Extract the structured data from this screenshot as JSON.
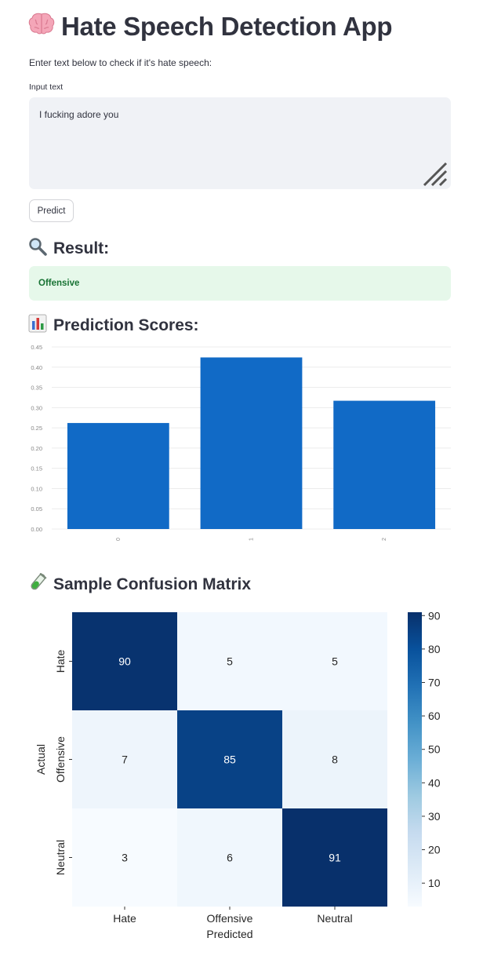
{
  "app": {
    "title": "Hate Speech Detection App",
    "title_icon": "brain-icon",
    "instruction": "Enter text below to check if it's hate speech:"
  },
  "input": {
    "label": "Input text",
    "value": "I fucking adore you"
  },
  "predict_button": {
    "label": "Predict"
  },
  "result": {
    "heading": "Result:",
    "heading_icon": "magnifier-icon",
    "value": "Offensive",
    "colors": {
      "background": "#e6f8ea",
      "text": "#177233"
    }
  },
  "scores_section": {
    "heading": "Prediction Scores:",
    "heading_icon": "bar-chart-icon"
  },
  "matrix_section": {
    "heading": "Sample Confusion Matrix",
    "heading_icon": "test-tube-icon"
  },
  "chart_data": [
    {
      "type": "bar",
      "categories": [
        "0",
        "1",
        "2"
      ],
      "values": [
        0.262,
        0.424,
        0.317
      ],
      "ylim": [
        0,
        0.45
      ],
      "yticks": [
        "0.00",
        "0.05",
        "0.10",
        "0.15",
        "0.20",
        "0.25",
        "0.30",
        "0.35",
        "0.40",
        "0.45"
      ],
      "grid": true,
      "color": "#116ac6"
    },
    {
      "type": "heatmap",
      "x_categories": [
        "Hate",
        "Offensive",
        "Neutral"
      ],
      "y_categories": [
        "Hate",
        "Offensive",
        "Neutral"
      ],
      "xlabel": "Predicted",
      "ylabel": "Actual",
      "values": [
        [
          90,
          5,
          5
        ],
        [
          7,
          85,
          8
        ],
        [
          3,
          6,
          91
        ]
      ],
      "colorbar_ticks": [
        10,
        20,
        30,
        40,
        50,
        60,
        70,
        80,
        90
      ],
      "colorbar_range": [
        3,
        91
      ],
      "colormap": "Blues"
    }
  ]
}
